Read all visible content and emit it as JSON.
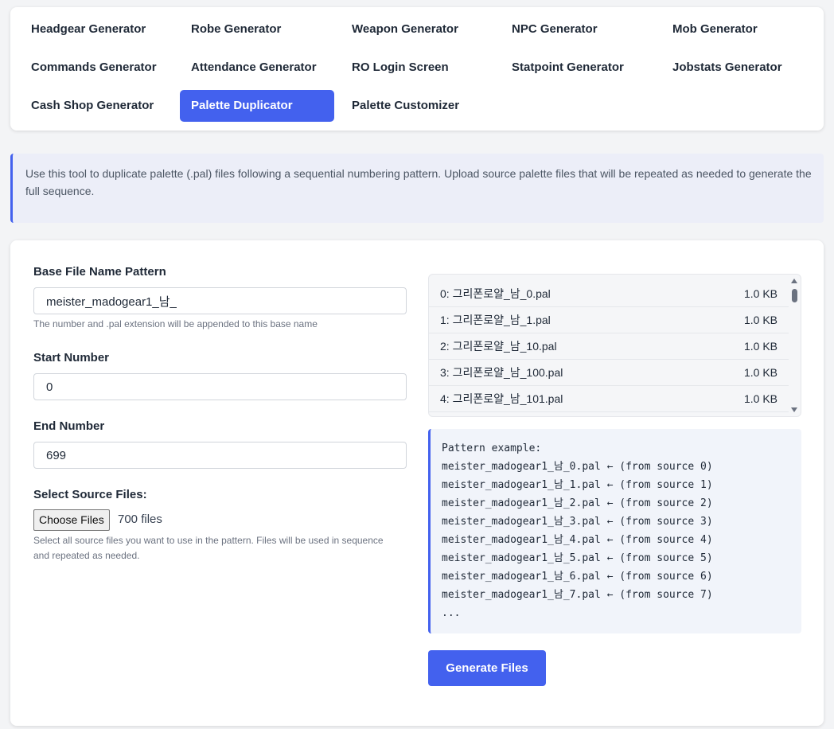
{
  "nav": {
    "items": [
      {
        "label": "Headgear Generator"
      },
      {
        "label": "Robe Generator"
      },
      {
        "label": "Weapon Generator"
      },
      {
        "label": "NPC Generator"
      },
      {
        "label": "Mob Generator"
      },
      {
        "label": "Commands Generator"
      },
      {
        "label": "Attendance Generator"
      },
      {
        "label": "RO Login Screen"
      },
      {
        "label": "Statpoint Generator"
      },
      {
        "label": "Jobstats Generator"
      },
      {
        "label": "Cash Shop Generator"
      },
      {
        "label": "Palette Duplicator",
        "active": true
      },
      {
        "label": "Palette Customizer"
      }
    ]
  },
  "info": {
    "text": "Use this tool to duplicate palette (.pal) files following a sequential numbering pattern. Upload source palette files that will be repeated as needed to generate the full sequence."
  },
  "form": {
    "base_name_label": "Base File Name Pattern",
    "base_name_value": "meister_madogear1_남_",
    "base_name_hint": "The number and .pal extension will be appended to this base name",
    "start_label": "Start Number",
    "start_value": "0",
    "end_label": "End Number",
    "end_value": "699",
    "source_label": "Select Source Files:",
    "choose_files_label": "Choose Files",
    "file_count": "700 files",
    "source_hint_line1": "Select all source files you want to use in the pattern. Files will be used in sequence",
    "source_hint_line2": "and repeated as needed."
  },
  "file_list": [
    {
      "name": "0: 그리폰로얄_남_0.pal",
      "size": "1.0 KB"
    },
    {
      "name": "1: 그리폰로얄_남_1.pal",
      "size": "1.0 KB"
    },
    {
      "name": "2: 그리폰로얄_남_10.pal",
      "size": "1.0 KB"
    },
    {
      "name": "3: 그리폰로얄_남_100.pal",
      "size": "1.0 KB"
    },
    {
      "name": "4: 그리폰로얄_남_101.pal",
      "size": "1.0 KB"
    }
  ],
  "pattern": {
    "lines": [
      "Pattern example:",
      "meister_madogear1_남_0.pal ← (from source 0)",
      "meister_madogear1_남_1.pal ← (from source 1)",
      "meister_madogear1_남_2.pal ← (from source 2)",
      "meister_madogear1_남_3.pal ← (from source 3)",
      "meister_madogear1_남_4.pal ← (from source 4)",
      "meister_madogear1_남_5.pal ← (from source 5)",
      "meister_madogear1_남_6.pal ← (from source 6)",
      "meister_madogear1_남_7.pal ← (from source 7)",
      "..."
    ]
  },
  "actions": {
    "generate_label": "Generate Files"
  },
  "colors": {
    "accent": "#4361ee",
    "page_bg": "#f3f4f6",
    "info_bg": "#eceef8"
  }
}
